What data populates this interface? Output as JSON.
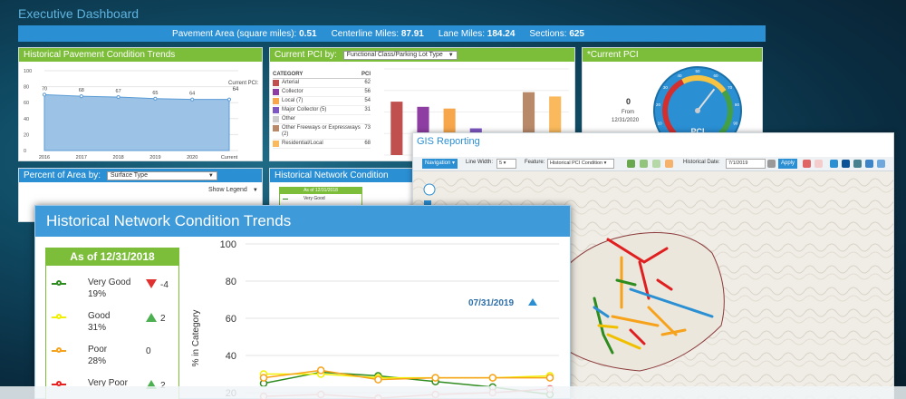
{
  "dashboard": {
    "title": "Executive Dashboard",
    "summary": [
      {
        "label": "Pavement Area (square miles):",
        "value": "0.51"
      },
      {
        "label": "Centerline Miles:",
        "value": "87.91"
      },
      {
        "label": "Lane Miles:",
        "value": "184.24"
      },
      {
        "label": "Sections:",
        "value": "625"
      }
    ]
  },
  "hist_pavement": {
    "title": "Historical Pavement Condition Trends",
    "current_label": "Current PCI:",
    "current_value": "64",
    "chart_data": {
      "type": "area",
      "categories": [
        "2016",
        "2017",
        "2018",
        "2019",
        "2020",
        "Current"
      ],
      "values": [
        70,
        68,
        67,
        65,
        64,
        64
      ],
      "ylim": [
        0,
        100
      ],
      "yticks": [
        "100",
        "80",
        "60",
        "40",
        "20",
        "0"
      ]
    }
  },
  "current_pci_by": {
    "title": "Current PCI by:",
    "select_value": "Functional Class/Parking Lot Type",
    "table_headers": [
      "CATEGORY",
      "PCI"
    ],
    "chart_data": {
      "type": "bar",
      "categories": [
        "Arterial",
        "Collector",
        "Local (7)",
        "Major Collector (5)",
        "Other",
        "Other Freeways or Expressways (2)",
        "Residential/Local"
      ],
      "values": [
        62,
        56,
        54,
        31,
        "",
        73,
        68
      ],
      "colors": [
        "#c0504d",
        "#8e3ea3",
        "#f7a64b",
        "#7e57c2",
        "#cccccc",
        "#b88a6a",
        "#f9b95c"
      ],
      "ylim": [
        0,
        100
      ]
    }
  },
  "current_pci": {
    "title": "*Current PCI",
    "value": "0",
    "from_label": "From",
    "from_date": "12/31/2020",
    "gauge_label": "PCI",
    "gauge_value": "64",
    "gauge_ticks": [
      "0",
      "10",
      "20",
      "30",
      "40",
      "50",
      "60",
      "70",
      "80",
      "90",
      "100"
    ]
  },
  "percent_area": {
    "title": "Percent of Area by:",
    "select_value": "Surface Type",
    "show_legend": "Show Legend"
  },
  "hist_network_small": {
    "title": "Historical Network Condition Trends",
    "as_of": "As of 12/31/2018",
    "first_item": "Very Good"
  },
  "hist_network": {
    "title": "Historical Network Condition Trends",
    "as_of": "As of 12/31/2018",
    "date_marker": "07/31/2019",
    "ylabel": "% in Category",
    "legend": [
      {
        "name": "Very Good",
        "percent": "19%",
        "change": "-4",
        "dir": "down",
        "color": "#2e8b1e"
      },
      {
        "name": "Good",
        "percent": "31%",
        "change": "2",
        "dir": "up",
        "color": "#f0f000"
      },
      {
        "name": "Poor",
        "percent": "28%",
        "change": "0",
        "dir": "none",
        "color": "#f7a21b"
      },
      {
        "name": "Very Poor",
        "percent": "",
        "change": "2",
        "dir": "up",
        "color": "#e82020"
      }
    ],
    "chart_data": {
      "type": "line",
      "ylim": [
        20,
        100
      ],
      "yticks": [
        "100",
        "80",
        "60",
        "40",
        "20"
      ],
      "series": [
        {
          "name": "Very Good",
          "color": "#2e8b1e",
          "values": [
            25,
            31,
            29,
            26,
            23,
            19
          ]
        },
        {
          "name": "Good",
          "color": "#f0f000",
          "values": [
            30,
            30,
            28,
            28,
            28,
            29
          ]
        },
        {
          "name": "Poor",
          "color": "#f7a21b",
          "values": [
            28,
            32,
            27,
            28,
            28,
            28
          ]
        },
        {
          "name": "Very Poor",
          "color": "#f08080",
          "values": [
            18,
            19,
            17,
            19,
            20,
            22
          ]
        }
      ]
    }
  },
  "gis": {
    "title": "GIS Reporting",
    "navigation": "Navigation",
    "line_width_label": "Line Width:",
    "line_width_value": "5",
    "feature_label": "Feature:",
    "feature_value": "Historical PCI Condition",
    "hist_date_label": "Historical Date:",
    "hist_date_value": "7/1/2019",
    "apply": "Apply"
  }
}
